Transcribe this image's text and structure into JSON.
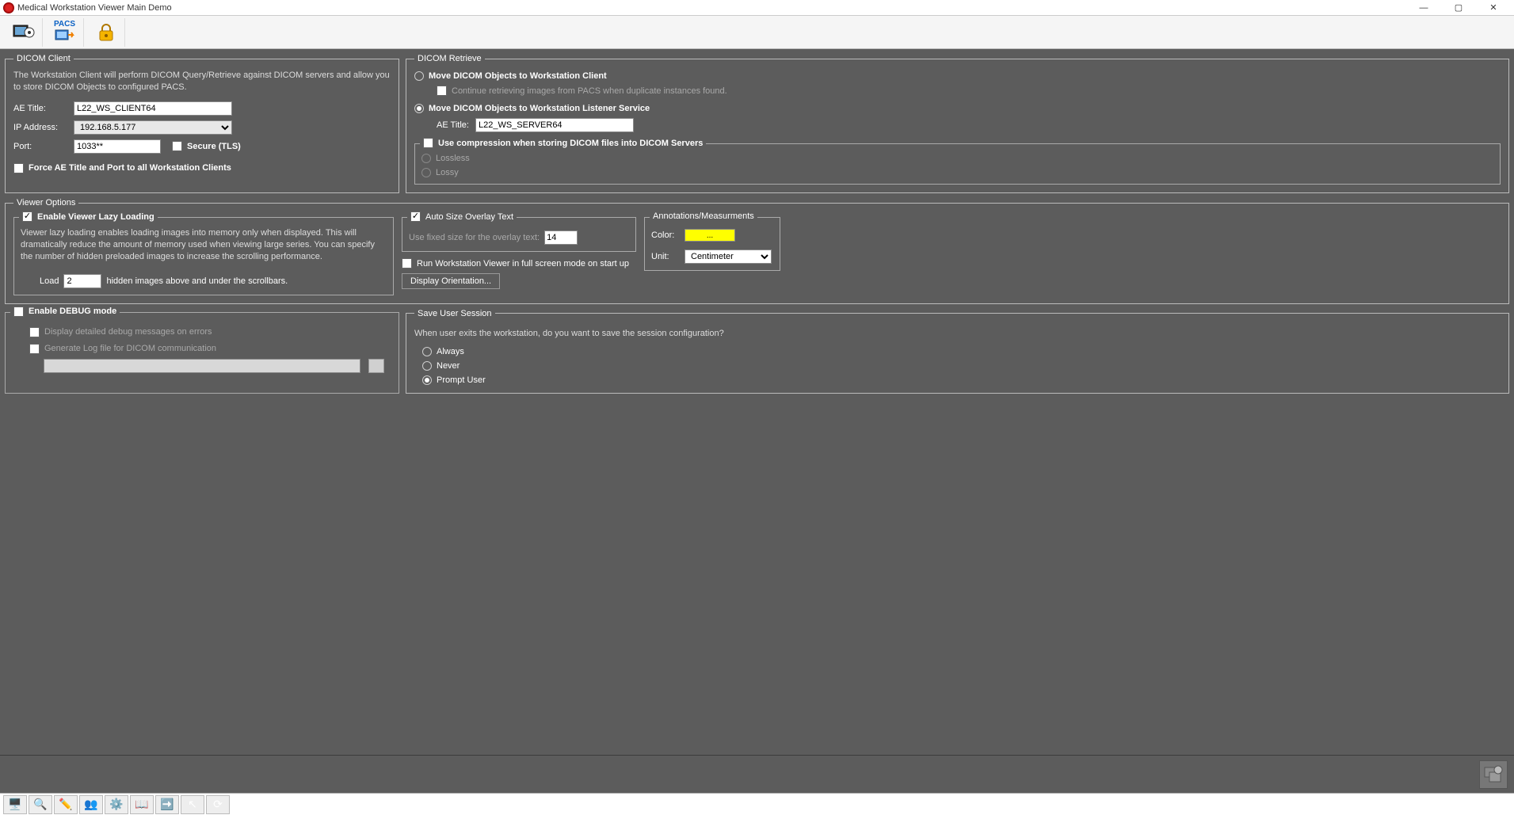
{
  "window": {
    "title": "Medical Workstation Viewer Main Demo",
    "min": "—",
    "max": "▢",
    "close": "✕"
  },
  "toolbar": {
    "btn1_name": "settings-icon",
    "btn2_label": "PACS",
    "btn3_name": "lock-icon"
  },
  "dicom_client": {
    "legend": "DICOM Client",
    "desc": "The Workstation Client will perform DICOM Query/Retrieve against DICOM servers and allow you to store DICOM Objects to configured PACS.",
    "ae_title_label": "AE Title:",
    "ae_title_value": "L22_WS_CLIENT64",
    "ip_label": "IP Address:",
    "ip_value": "192.168.5.177",
    "port_label": "Port:",
    "port_value": "1033**",
    "secure_label": "Secure (TLS)",
    "force_label": "Force AE Title and Port to all Workstation Clients"
  },
  "dicom_retrieve": {
    "legend": "DICOM Retrieve",
    "opt1": "Move DICOM Objects to Workstation Client",
    "opt1_sub": "Continue retrieving images from PACS when duplicate instances found.",
    "opt2": "Move DICOM Objects to Workstation Listener Service",
    "opt2_ae_label": "AE Title:",
    "opt2_ae_value": "L22_WS_SERVER64",
    "compress_legend": "Use compression when storing DICOM files into DICOM Servers",
    "lossless": "Lossless",
    "lossy": "Lossy"
  },
  "viewer_options": {
    "legend": "Viewer Options",
    "lazy_legend": "Enable Viewer Lazy Loading",
    "lazy_desc": "Viewer lazy loading enables loading images into memory only when displayed. This will dramatically reduce the amount of memory used when viewing large series. You can specify the number of hidden preloaded images to increase the scrolling performance.",
    "load_label": "Load",
    "load_value": "2",
    "load_suffix": "hidden images above and under the scrollbars.",
    "autosize_legend": "Auto Size Overlay Text",
    "fixed_label": "Use fixed size for the overlay text:",
    "fixed_value": "14",
    "fullscreen": "Run Workstation Viewer in full screen mode on start up",
    "display_orientation_btn": "Display Orientation...",
    "annot_legend": "Annotations/Measurments",
    "color_label": "Color:",
    "color_btn": "...",
    "unit_label": "Unit:",
    "unit_value": "Centimeter"
  },
  "debug": {
    "legend": "Enable DEBUG mode",
    "detailed": "Display detailed debug messages on errors",
    "genlog": "Generate Log file for DICOM communication",
    "path_value": ""
  },
  "save_session": {
    "legend": "Save User Session",
    "question": "When user exits the workstation, do you want to save the session configuration?",
    "always": "Always",
    "never": "Never",
    "prompt": "Prompt User"
  }
}
